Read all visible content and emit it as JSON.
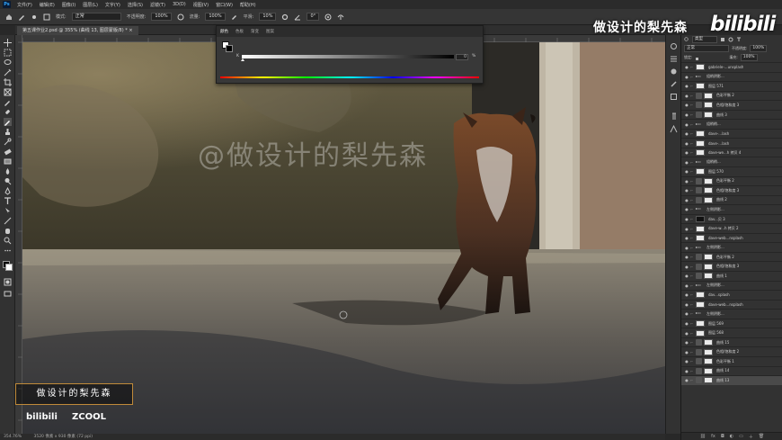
{
  "menubar": {
    "app_icon": "Ps",
    "items": [
      "文件(F)",
      "编辑(E)",
      "图像(I)",
      "图层(L)",
      "文字(Y)",
      "选择(S)",
      "滤镜(T)",
      "3D(D)",
      "视图(V)",
      "窗口(W)",
      "帮助(H)"
    ]
  },
  "options": {
    "mode_label": "模式:",
    "mode_value": "正常",
    "opacity_label": "不透明度:",
    "opacity_value": "100%",
    "flow_label": "流量:",
    "flow_value": "100%",
    "smooth_label": "平滑:",
    "smooth_value": "10%",
    "angle_value": "0°"
  },
  "document": {
    "tab_title": "第五课作业2.psd @ 355% (曲线 13, 图层蒙版/8) *"
  },
  "color_panel": {
    "tabs": [
      "颜色",
      "色板",
      "渐变",
      "图案"
    ],
    "channel_label": "K",
    "value": "0",
    "unit": "%"
  },
  "layers_panel": {
    "kind_label": "类型",
    "blend_mode": "正常",
    "opacity_label": "不透明度:",
    "opacity_value": "100%",
    "lock_label": "锁定:",
    "fill_label": "填充:",
    "fill_value": "100%",
    "rows": [
      {
        "name": "gabriele-...unsplash",
        "thumb": "photo"
      },
      {
        "name": "组梢阴影...",
        "thumb": "group"
      },
      {
        "name": "图层 571",
        "thumb": "photo"
      },
      {
        "name": "色彩平衡 2",
        "thumb": "adj"
      },
      {
        "name": "色相/饱和度 3",
        "thumb": "adj"
      },
      {
        "name": "曲线 3",
        "thumb": "adj"
      },
      {
        "name": "组梢梢...",
        "thumb": "group"
      },
      {
        "name": "dave-...lash",
        "thumb": "photo"
      },
      {
        "name": "dave-...lash",
        "thumb": "photo"
      },
      {
        "name": "dave-we...h 拷贝 4",
        "thumb": "photo"
      },
      {
        "name": "组梢梢...",
        "thumb": "group"
      },
      {
        "name": "图层 570",
        "thumb": "photo"
      },
      {
        "name": "色彩平衡 2",
        "thumb": "adj"
      },
      {
        "name": "色相/饱和度 3",
        "thumb": "adj"
      },
      {
        "name": "曲线 2",
        "thumb": "adj"
      },
      {
        "name": "左侧阴影...",
        "thumb": "group"
      },
      {
        "name": "dav...贝 3",
        "thumb": "dark"
      },
      {
        "name": "dave-w...h 拷贝 2",
        "thumb": "photo"
      },
      {
        "name": "dave-web...nsplash",
        "thumb": "photo"
      },
      {
        "name": "左侧阴影...",
        "thumb": "group"
      },
      {
        "name": "色彩平衡 2",
        "thumb": "adj"
      },
      {
        "name": "色相/饱和度 3",
        "thumb": "adj"
      },
      {
        "name": "曲线 1",
        "thumb": "adj"
      },
      {
        "name": "左侧阴影...",
        "thumb": "group"
      },
      {
        "name": "dav...splash",
        "thumb": "photo"
      },
      {
        "name": "dave-web...nsplash",
        "thumb": "photo"
      },
      {
        "name": "左侧阴影...",
        "thumb": "group"
      },
      {
        "name": "图层 569",
        "thumb": "photo"
      },
      {
        "name": "图层 568",
        "thumb": "photo"
      },
      {
        "name": "曲线 15",
        "thumb": "adj"
      },
      {
        "name": "色相/饱和度 2",
        "thumb": "adj"
      },
      {
        "name": "色彩平衡 1",
        "thumb": "adj"
      },
      {
        "name": "曲线 14",
        "thumb": "adj"
      },
      {
        "name": "曲线 13",
        "thumb": "adj",
        "selected": true
      }
    ],
    "footer_icons": [
      "link-icon",
      "fx-icon",
      "mask-icon",
      "adjustment-icon",
      "folder-icon",
      "new-layer-icon",
      "trash-icon"
    ]
  },
  "status": {
    "zoom": "354.76%",
    "size": "3520 像素 x 930 像素 (72 ppi)"
  },
  "watermarks": {
    "top_right_text": "做设计的梨先森",
    "bili_logo": "bilibili",
    "center_text": "@做设计的梨先森",
    "box_text": "做设计的梨先森",
    "logo_bilibili": "bilibili",
    "logo_zcool": "ZCOOL"
  },
  "colors": {
    "accent": "#31a8ff",
    "box_border": "#c08a3a"
  }
}
